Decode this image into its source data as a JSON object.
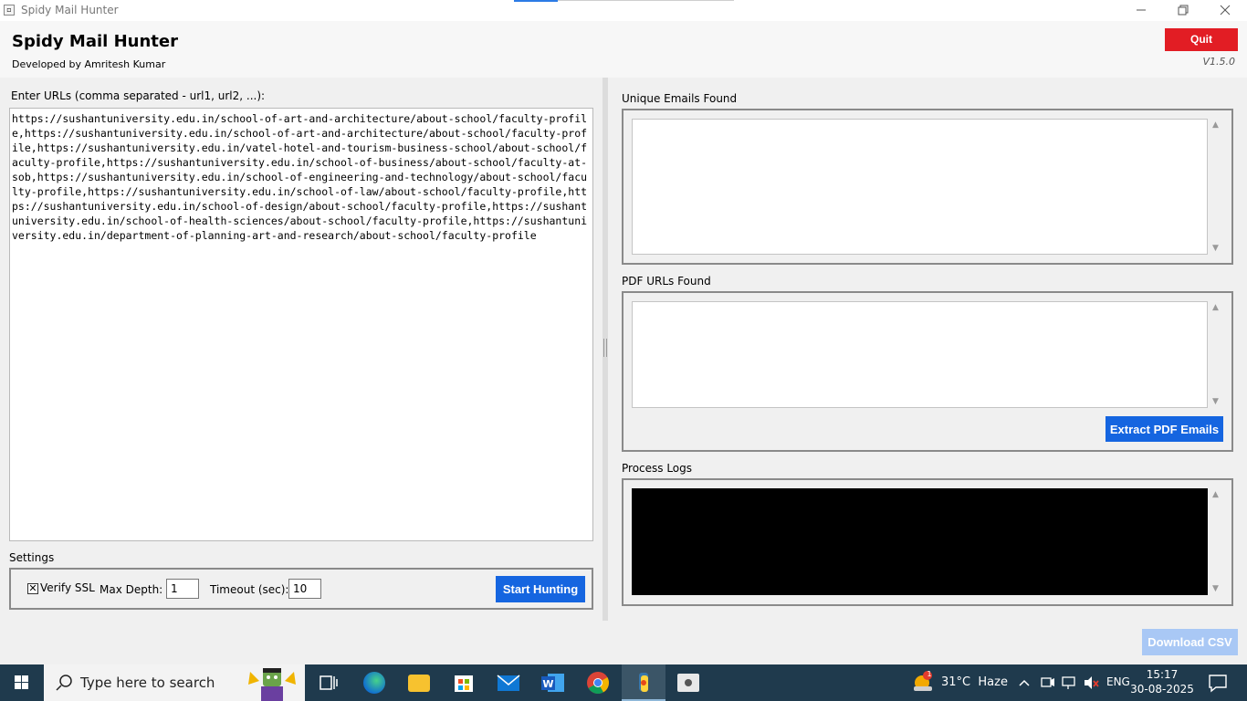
{
  "window": {
    "title": "Spidy Mail Hunter"
  },
  "header": {
    "app_title": "Spidy Mail Hunter",
    "subtitle": "Developed by Amritesh Kumar",
    "quit_label": "Quit",
    "version": "V1.5.0"
  },
  "left": {
    "url_label": "Enter URLs (comma separated - url1, url2, ...):",
    "urls_value": "https://sushantuniversity.edu.in/school-of-art-and-architecture/about-school/faculty-profile,https://sushantuniversity.edu.in/school-of-art-and-architecture/about-school/faculty-profile,https://sushantuniversity.edu.in/vatel-hotel-and-tourism-business-school/about-school/faculty-profile,https://sushantuniversity.edu.in/school-of-business/about-school/faculty-at-sob,https://sushantuniversity.edu.in/school-of-engineering-and-technology/about-school/faculty-profile,https://sushantuniversity.edu.in/school-of-law/about-school/faculty-profile,https://sushantuniversity.edu.in/school-of-design/about-school/faculty-profile,https://sushantuniversity.edu.in/school-of-health-sciences/about-school/faculty-profile,https://sushantuniversity.edu.in/department-of-planning-art-and-research/about-school/faculty-profile"
  },
  "settings": {
    "label": "Settings",
    "verify_ssl_label": "Verify SSL",
    "verify_ssl_checked": "✕",
    "max_depth_label": "Max Depth:",
    "max_depth_value": "1",
    "timeout_label": "Timeout (sec):",
    "timeout_value": "10",
    "start_label": "Start Hunting"
  },
  "right": {
    "emails_label": "Unique Emails Found",
    "pdf_label": "PDF URLs Found",
    "extract_label": "Extract PDF Emails",
    "logs_label": "Process Logs"
  },
  "bottom": {
    "download_label": "Download CSV"
  },
  "taskbar": {
    "search_placeholder": "Type here to search",
    "weather": "31°C  Haze",
    "weather_badge": "1",
    "language": "ENG",
    "time": "15:17",
    "date": "30-08-2025"
  },
  "colors": {
    "quit": "#e21d24",
    "primary": "#1565e0",
    "disabled": "#a9c8f5",
    "taskbar": "#1f3a4d"
  }
}
